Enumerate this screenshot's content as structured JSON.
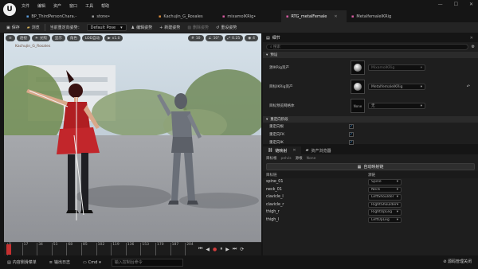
{
  "menu": [
    "文件",
    "编辑",
    "资产",
    "窗口",
    "工具",
    "帮助"
  ],
  "tabs": [
    {
      "label": "BP_ThirdPersonChara.-",
      "active": false
    },
    {
      "label": "stone•",
      "active": false
    },
    {
      "label": "Kachujin_G_Rosales",
      "active": false
    },
    {
      "label": "mixamolKRig•",
      "active": false
    },
    {
      "label": "RTG_metalFemale",
      "active": true
    },
    {
      "label": "MetalfemaleIKRig",
      "active": false
    }
  ],
  "toolbar": {
    "save": "保存",
    "browse": "浏览",
    "current_pose_label": "当前重定向姿势：",
    "pose_value": "Default Pose",
    "edit_pose": "编辑姿势",
    "new_pose": "新建姿势",
    "delete_pose": "删除姿势",
    "reset_pose": "重设姿势"
  },
  "viewport": {
    "perspective": "透视",
    "lit": "光照",
    "show": "显示",
    "character": "角色",
    "lod": "LOD自动",
    "speed": "x1.0",
    "grid_snap": "10",
    "rot_snap": "10°",
    "scale_snap": "0.25",
    "cam_speed": "4",
    "source_label": "Kachujin_G_Rosales"
  },
  "timeline": {
    "ticks": [
      "0",
      "17",
      "34",
      "51",
      "68",
      "85",
      "102",
      "119",
      "136",
      "153",
      "170",
      "187",
      "204"
    ]
  },
  "details": {
    "title": "细节",
    "search_placeholder": "搜索",
    "section_setup": "预设",
    "source_rig_label": "源IKRig资产",
    "source_rig_value": "MixamoIKRig",
    "target_rig_label": "目标IKRig资产",
    "target_rig_value": "MetalfemaleIKRig",
    "target_mesh_label": "目标预览网格体",
    "target_mesh_value": "无",
    "thumb_none": "None",
    "section_retarget": "重定向阶段",
    "row_root": "重定向根",
    "row_fk": "重定向FK",
    "row_ik": "重定向IK"
  },
  "chains": {
    "tab_active": "链映射",
    "tab_other": "资产浏览器",
    "target_root_label": "目标根",
    "target_root_value": "pelvis",
    "source_root_label": "源根",
    "source_root_value": "None",
    "auto_map": "自动映射链",
    "col_target": "目标链",
    "col_source": "源链",
    "rows": [
      {
        "target": "spine_01",
        "source": "Spine"
      },
      {
        "target": "neck_01",
        "source": "Neck"
      },
      {
        "target": "clavicle_l",
        "source": "LeftShoulder"
      },
      {
        "target": "clavicle_r",
        "source": "RightShoulder"
      },
      {
        "target": "thigh_r",
        "source": "RightUpLeg"
      },
      {
        "target": "thigh_l",
        "source": "LeftUpLeg"
      }
    ]
  },
  "statusbar": {
    "content_drawer": "内容侧滑菜单",
    "output_log": "输出日志",
    "cmd": "Cmd",
    "cmd_placeholder": "输入控制台命令",
    "source_control": "源码管理关闭"
  }
}
